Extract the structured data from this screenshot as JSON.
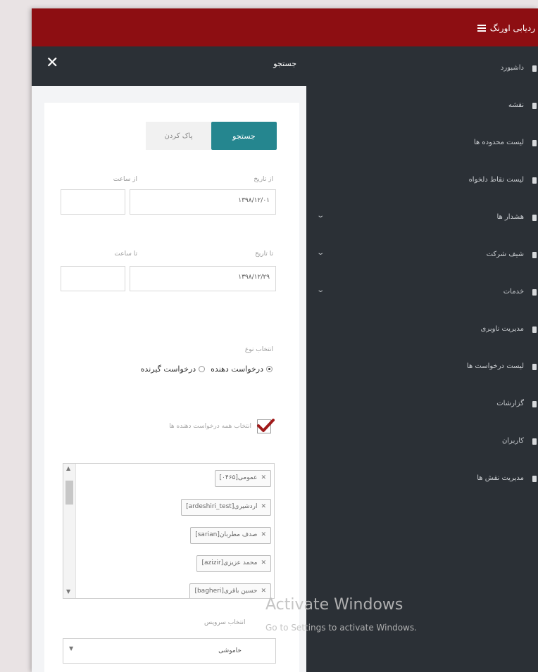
{
  "app": {
    "title": "ردیابی اورنگ"
  },
  "sidebar": {
    "items": [
      {
        "label": "داشبورد",
        "has_submenu": false
      },
      {
        "label": "نقشه",
        "has_submenu": false
      },
      {
        "label": "لیست محدوده ها",
        "has_submenu": false
      },
      {
        "label": "لیست نقاط دلخواه",
        "has_submenu": false
      },
      {
        "label": "هشدار ها",
        "has_submenu": true
      },
      {
        "label": "شیف شرکت",
        "has_submenu": true
      },
      {
        "label": "خدمات",
        "has_submenu": true
      },
      {
        "label": "مدیریت ناوبری",
        "has_submenu": false
      },
      {
        "label": "لیست درخواست ها",
        "has_submenu": false
      },
      {
        "label": "گزارشات",
        "has_submenu": false
      },
      {
        "label": "کاربران",
        "has_submenu": false
      },
      {
        "label": "مدیریت نقش ها",
        "has_submenu": false
      }
    ]
  },
  "search_panel": {
    "title": "جستجو",
    "close_glyph": "✕",
    "search_button": "جستجو",
    "clear_button": "پاک کردن",
    "from_date_label": "از تاریخ",
    "from_time_label": "از ساعت",
    "from_date_value": "۱۳۹۸/۱۲/۰۱",
    "from_time_value": "",
    "to_date_label": "تا تاریخ",
    "to_time_label": "تا ساعت",
    "to_date_value": "۱۳۹۸/۱۲/۲۹",
    "to_time_value": "",
    "type_label": "انتخاب نوع",
    "type_options": [
      "درخواست دهنده",
      "درخواست گیرنده"
    ],
    "type_selected": "درخواست دهنده",
    "select_all_label": "انتخاب همه درخواست دهنده ها",
    "select_all_checked": true,
    "chips": [
      "عمومی[۰۴۶۵]",
      "اردشیری[ardeshiri_test]",
      "صدف مطربان[sarian]",
      "محمد عزیزی[azizir]",
      "حسین باقری[bagheri]"
    ],
    "service_label": "انتخاب سرویس",
    "service_value": "خاموشی"
  },
  "watermark": {
    "line1": "Activate Windows",
    "line2": "Go to Settings to activate Windows."
  },
  "colors": {
    "topbar": "#8d0e12",
    "sidebar": "#2b3036",
    "accent": "#25868f",
    "check": "#a01a1a"
  }
}
